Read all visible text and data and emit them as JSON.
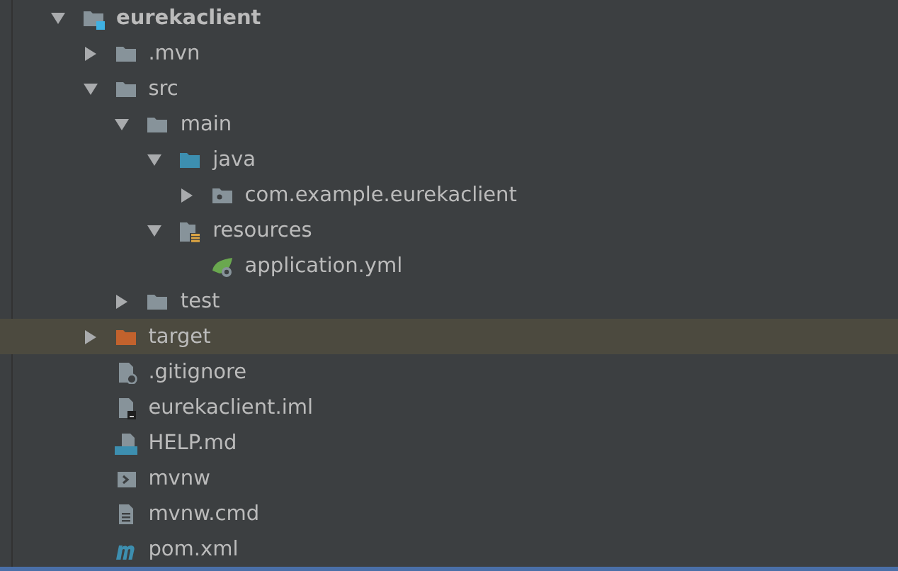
{
  "tree": [
    {
      "label": "eurekaclient",
      "kind": "module",
      "expanded": true,
      "selected": false,
      "children": [
        {
          "label": ".mvn",
          "kind": "folder",
          "expanded": false,
          "selected": false
        },
        {
          "label": "src",
          "kind": "folder",
          "expanded": true,
          "selected": false,
          "children": [
            {
              "label": "main",
              "kind": "folder",
              "expanded": true,
              "selected": false,
              "children": [
                {
                  "label": "java",
                  "kind": "source-folder",
                  "expanded": true,
                  "selected": false,
                  "children": [
                    {
                      "label": "com.example.eurekaclient",
                      "kind": "package",
                      "expanded": false,
                      "selected": false
                    }
                  ]
                },
                {
                  "label": "resources",
                  "kind": "resource-folder",
                  "expanded": true,
                  "selected": false,
                  "children": [
                    {
                      "label": "application.yml",
                      "kind": "spring-file",
                      "selected": false
                    }
                  ]
                }
              ]
            },
            {
              "label": "test",
              "kind": "folder",
              "expanded": false,
              "selected": false
            }
          ]
        },
        {
          "label": "target",
          "kind": "excluded-folder",
          "expanded": false,
          "selected": true
        },
        {
          "label": ".gitignore",
          "kind": "ignore-file",
          "selected": false
        },
        {
          "label": "eurekaclient.iml",
          "kind": "module-file",
          "selected": false
        },
        {
          "label": "HELP.md",
          "kind": "markdown-file",
          "selected": false
        },
        {
          "label": "mvnw",
          "kind": "script-file",
          "selected": false
        },
        {
          "label": "mvnw.cmd",
          "kind": "text-file",
          "selected": false
        },
        {
          "label": "pom.xml",
          "kind": "maven-file",
          "selected": false
        }
      ]
    }
  ]
}
